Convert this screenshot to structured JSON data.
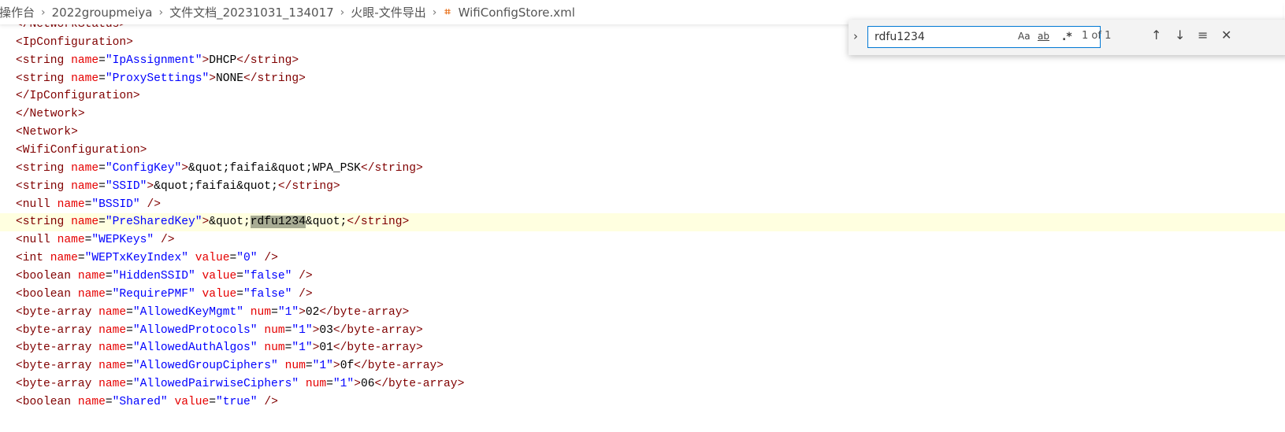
{
  "breadcrumb": [
    "操作台",
    "2022groupmeiya",
    "文件文档_20231031_134017",
    "火眼-文件导出",
    "WifiConfigStore.xml"
  ],
  "file_icon": "rss-icon",
  "find": {
    "value": "rdfu1234",
    "match_case": "Aa",
    "whole_word": "ab",
    "regex": ".*",
    "count": "1 of 1",
    "icons": [
      "chevron-right-icon",
      "arrow-up-icon",
      "arrow-down-icon",
      "find-in-selection-icon",
      "close-icon"
    ]
  },
  "colors": {
    "tag": "#800000",
    "attr": "#e50000",
    "value": "#0000ff",
    "current_line": "#ffffe0",
    "match": "#a8ac94",
    "accent": "#0078d4"
  },
  "editor": {
    "current_line": 11,
    "lines": [
      "</NetworkStatus>",
      "<IpConfiguration>",
      "<string name=\"IpAssignment\">DHCP</string>",
      "<string name=\"ProxySettings\">NONE</string>",
      "</IpConfiguration>",
      "</Network>",
      "<Network>",
      "<WifiConfiguration>",
      "<string name=\"ConfigKey\">&quot;faifai&quot;WPA_PSK</string>",
      "<string name=\"SSID\">&quot;faifai&quot;</string>",
      "<null name=\"BSSID\" />",
      "<string name=\"PreSharedKey\">&quot;rdfu1234&quot;</string>",
      "<null name=\"WEPKeys\" />",
      "<int name=\"WEPTxKeyIndex\" value=\"0\" />",
      "<boolean name=\"HiddenSSID\" value=\"false\" />",
      "<boolean name=\"RequirePMF\" value=\"false\" />",
      "<byte-array name=\"AllowedKeyMgmt\" num=\"1\">02</byte-array>",
      "<byte-array name=\"AllowedProtocols\" num=\"1\">03</byte-array>",
      "<byte-array name=\"AllowedAuthAlgos\" num=\"1\">01</byte-array>",
      "<byte-array name=\"AllowedGroupCiphers\" num=\"1\">0f</byte-array>",
      "<byte-array name=\"AllowedPairwiseCiphers\" num=\"1\">06</byte-array>",
      "<boolean name=\"Shared\" value=\"true\" />"
    ]
  }
}
